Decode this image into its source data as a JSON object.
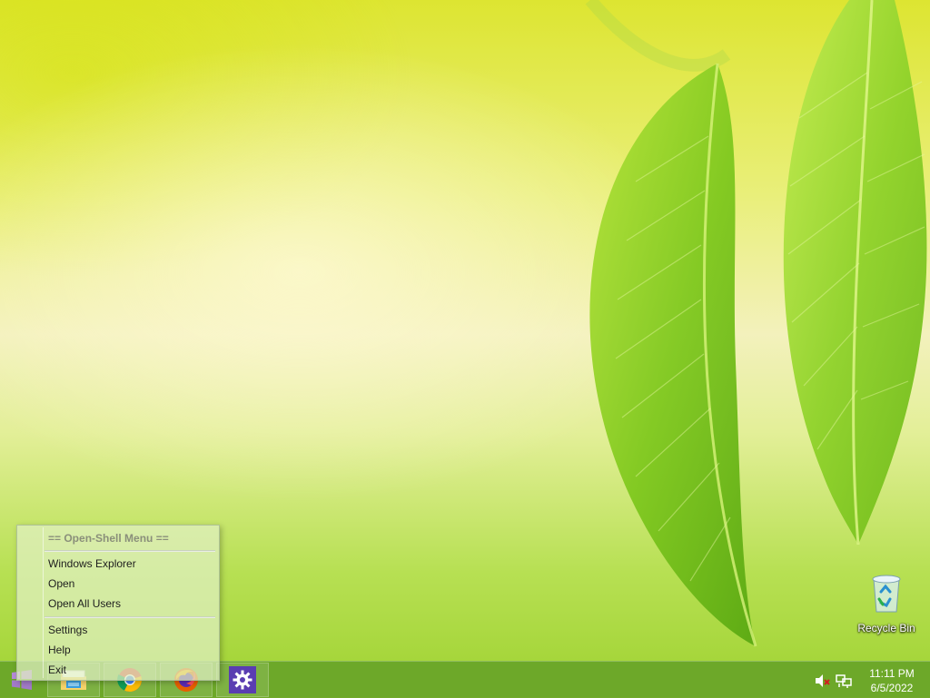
{
  "desktop": {
    "icons": [
      {
        "label": "Recycle Bin",
        "icon": "recycle-bin-icon"
      }
    ]
  },
  "context_menu": {
    "title": "== Open-Shell Menu ==",
    "items": [
      {
        "label": "Windows Explorer"
      },
      {
        "label": "Open"
      },
      {
        "label": "Open All Users"
      },
      {
        "label": "Settings"
      },
      {
        "label": "Help"
      },
      {
        "label": "Exit"
      }
    ]
  },
  "taskbar": {
    "start_icon": "windows-logo-icon",
    "pinned": [
      {
        "icon": "file-explorer-icon"
      },
      {
        "icon": "chrome-icon"
      },
      {
        "icon": "firefox-icon"
      },
      {
        "icon": "settings-gear-icon"
      }
    ],
    "tray": {
      "volume_icon": "volume-muted-icon",
      "network_icon": "network-icon"
    },
    "clock": {
      "time": "11:11 PM",
      "date": "6/5/2022"
    }
  },
  "colors": {
    "taskbar": "#68a428",
    "menu_bg": "#e1f0c3",
    "settings_tile": "#5a3db1"
  }
}
